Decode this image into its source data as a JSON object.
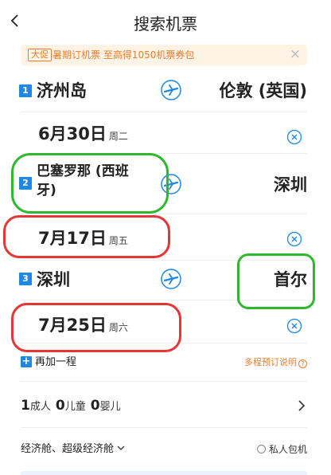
{
  "header": {
    "title": "搜索机票",
    "back_icon": "chevron-left-icon"
  },
  "promo": {
    "tag": "大促",
    "text": "暑期订机票 至高得1050机票券包",
    "close_glyph": "×"
  },
  "legs": [
    {
      "index": "1",
      "from": "济州岛",
      "to": "伦敦 (英国)",
      "date": "6月30日",
      "weekday": "周二"
    },
    {
      "index": "2",
      "from_line1": "巴塞罗那 (西班",
      "from_line2": "牙)",
      "to": "深圳",
      "date": "7月17日",
      "weekday": "周五"
    },
    {
      "index": "3",
      "from": "深圳",
      "to": "首尔",
      "date": "7月25日",
      "weekday": "周六"
    }
  ],
  "add_leg": {
    "plus": "+",
    "label": "再加一程",
    "help_label": "多程预订说明",
    "help_glyph": "?"
  },
  "passengers": {
    "adults": "1",
    "adults_label": "成人",
    "children": "0",
    "children_label": "儿童",
    "infants": "0",
    "infants_label": "婴儿"
  },
  "cabin": {
    "selected": "经济舱、超级经济舱",
    "charter_label": "私人包机"
  },
  "colors": {
    "accent_blue": "#1e88e5",
    "promo_orange": "#f07c2b",
    "annotation_green": "#2eb82e",
    "annotation_red": "#e53535"
  }
}
